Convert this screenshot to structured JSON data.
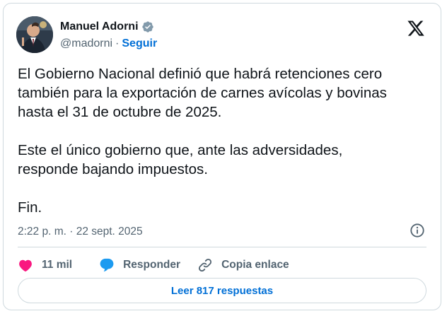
{
  "author": {
    "name": "Manuel Adorni",
    "handle": "@madorni",
    "separator": "·",
    "follow_label": "Seguir",
    "verified_color": "#829aab"
  },
  "tweet": {
    "text": "El Gobierno Nacional definió que habrá retenciones cero\ntambién para la exportación de carnes avícolas y bovinas\nhasta el 31 de octubre de 2025.\n\nEste el único gobierno que, ante las adversidades,\nresponde bajando impuestos.\n\nFin.",
    "timestamp": "2:22 p. m. · 22 sept. 2025"
  },
  "actions": {
    "likes": "11 mil",
    "reply_label": "Responder",
    "copy_link_label": "Copia enlace"
  },
  "read_replies_label": "Leer 817 respuestas",
  "colors": {
    "like": "#f91880",
    "reply": "#1d9bf0",
    "link": "#006fd6"
  },
  "icons": [
    "x-logo-icon",
    "verified-badge-icon",
    "info-icon",
    "heart-icon",
    "reply-bubble-icon",
    "link-icon"
  ]
}
